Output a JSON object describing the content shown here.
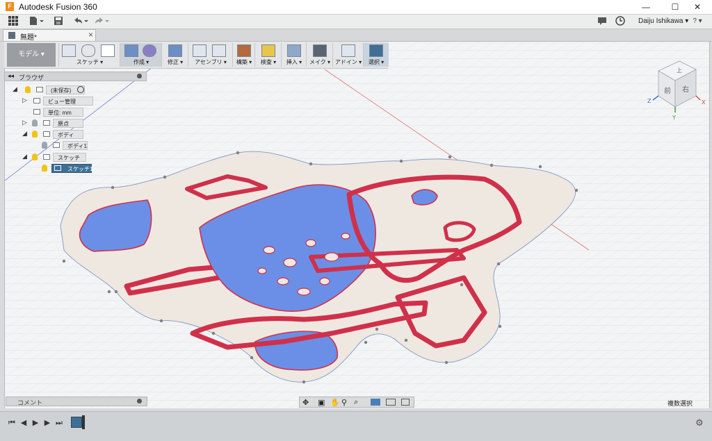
{
  "window": {
    "title": "Autodesk Fusion 360",
    "app_icon_letter": "F",
    "controls": {
      "minimize": "—",
      "maximize": "☐",
      "close": "✕"
    }
  },
  "quick_access": {
    "user_name": "Daiju Ishikawa ▾",
    "help": "? ▾"
  },
  "document_tab": {
    "label": "無題*",
    "close": "×"
  },
  "toolbar": {
    "workspace_label": "モデル ▾",
    "groups": [
      {
        "label": "スケッチ ▾"
      },
      {
        "label": "作成 ▾"
      },
      {
        "label": "修正 ▾"
      },
      {
        "label": "アセンブリ ▾"
      },
      {
        "label": "構築 ▾"
      },
      {
        "label": "検査 ▾"
      },
      {
        "label": "挿入 ▾"
      },
      {
        "label": "メイク ▾"
      },
      {
        "label": "アドイン ▾"
      },
      {
        "label": "選択 ▾"
      }
    ]
  },
  "browser": {
    "title": "ブラウザ",
    "nodes": [
      {
        "label": "(未保存)"
      },
      {
        "label": "ビュー管理"
      },
      {
        "label": "単位: mm"
      },
      {
        "label": "原点"
      },
      {
        "label": "ボディ"
      },
      {
        "label": "ボディ1"
      },
      {
        "label": "スケッチ"
      },
      {
        "label": "スケッチ1"
      }
    ]
  },
  "viewcube": {
    "top_label": "上",
    "front_label": "前",
    "right_label": "右",
    "axis_x": "X",
    "axis_y": "Y",
    "axis_z": "Z"
  },
  "comment_panel": {
    "label": "コメント"
  },
  "status": {
    "selection_mode": "複数選択"
  },
  "colors": {
    "sketch_fill": "#6b8fe6",
    "sketch_outline": "#d0304a",
    "profile_fill": "#efe8e1",
    "selection_accent": "#3f6f94"
  }
}
